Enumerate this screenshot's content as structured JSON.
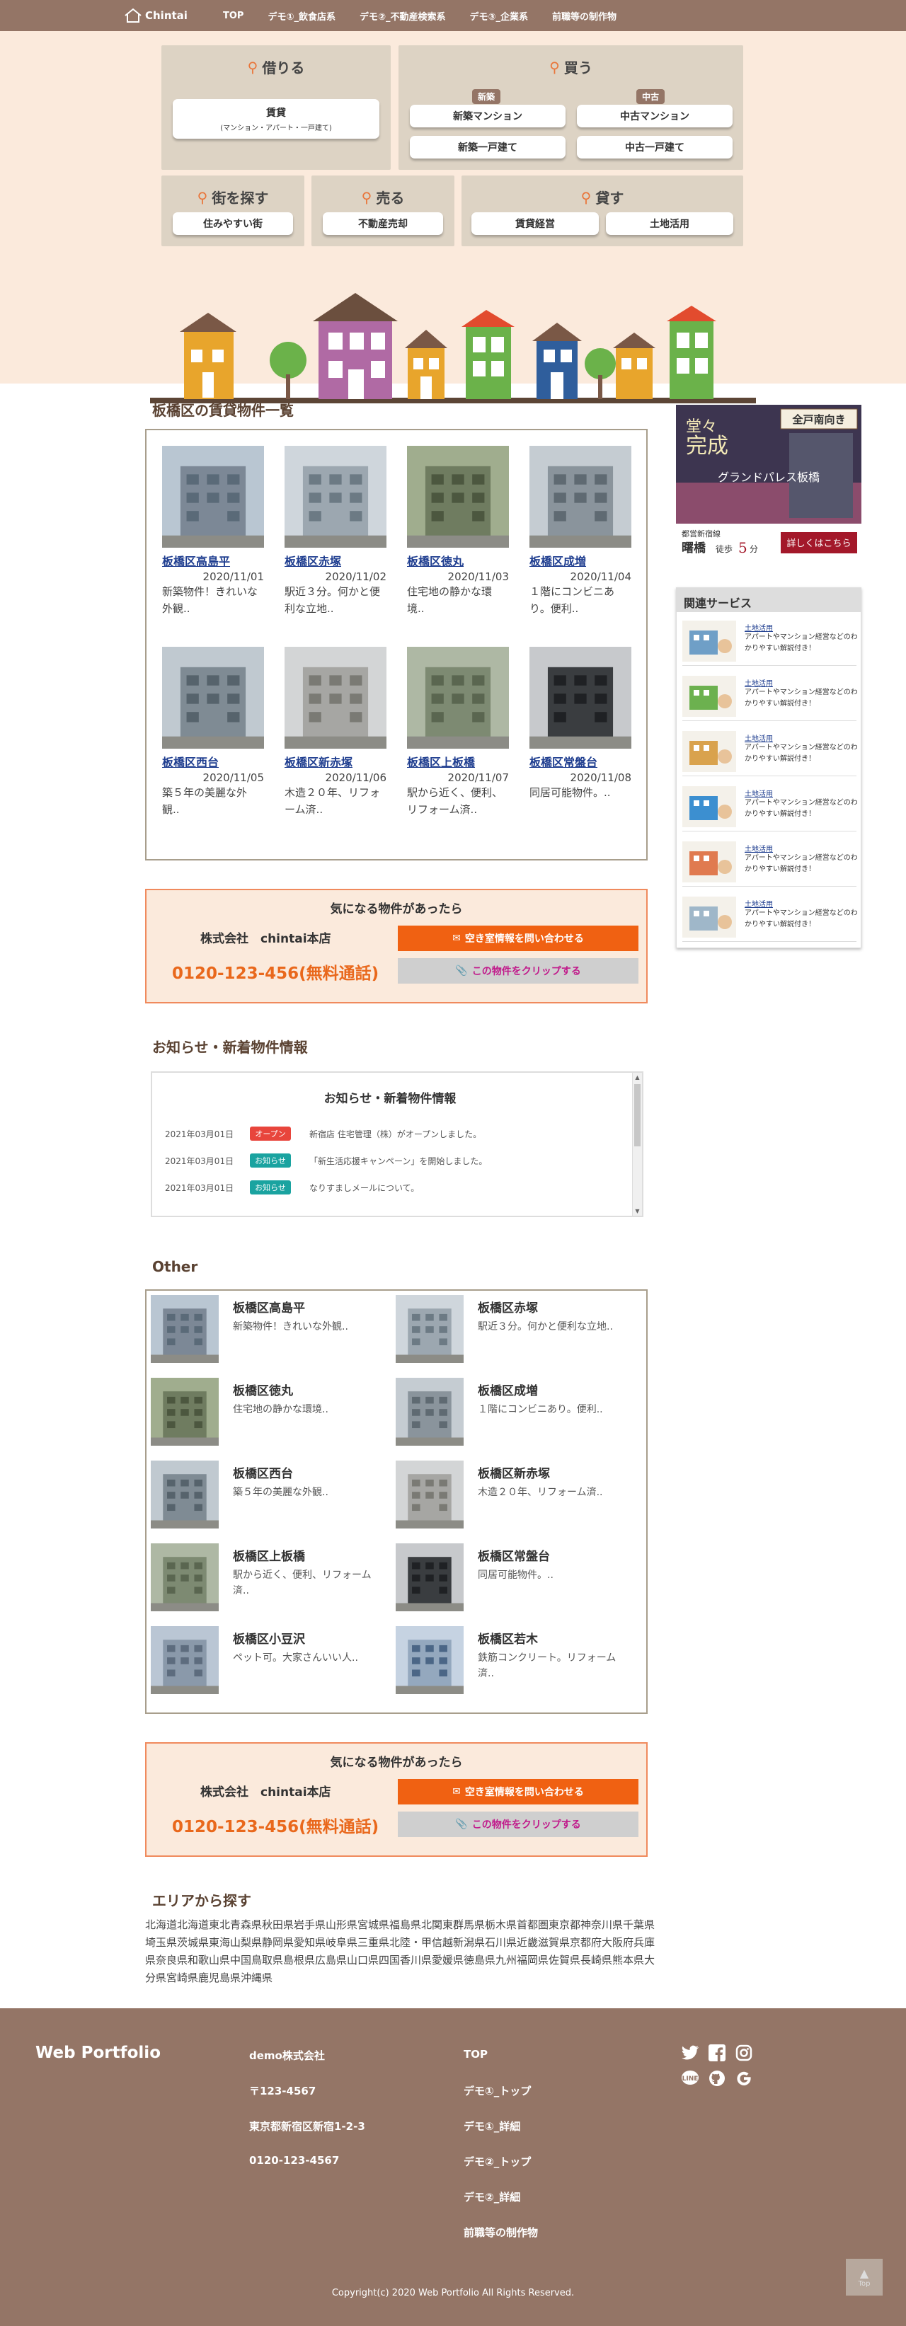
{
  "nav": {
    "logo": "Chintai",
    "links": [
      "TOP",
      "デモ①_飲食店系",
      "デモ②_不動産検索系",
      "デモ③_企業系",
      "前職等の制作物"
    ]
  },
  "hero": {
    "borrow": {
      "title": "借りる",
      "button": "賃貸",
      "button_sub": "(マンション・アパート・一戸建て)"
    },
    "buy": {
      "title": "買う",
      "tag_new": "新築",
      "tag_used": "中古",
      "btn1": "新築マンション",
      "btn2": "中古マンション",
      "btn3": "新築一戸建て",
      "btn4": "中古一戸建て"
    },
    "town": {
      "title": "街を探す",
      "button": "住みやすい街"
    },
    "sell": {
      "title": "売る",
      "button": "不動産売却"
    },
    "lend": {
      "title": "貸す",
      "btn1": "賃貸経営",
      "btn2": "土地活用"
    }
  },
  "listing": {
    "title": "板橋区の賃貸物件一覧",
    "cards": [
      {
        "name": "板橋区高島平",
        "date": "2020/11/01",
        "desc": "新築物件！きれいな外観.."
      },
      {
        "name": "板橋区赤塚",
        "date": "2020/11/02",
        "desc": "駅近３分。何かと便利な立地.."
      },
      {
        "name": "板橋区徳丸",
        "date": "2020/11/03",
        "desc": "住宅地の静かな環境.."
      },
      {
        "name": "板橋区成増",
        "date": "2020/11/04",
        "desc": "１階にコンビニあり。便利.."
      },
      {
        "name": "板橋区西台",
        "date": "2020/11/05",
        "desc": "築５年の美麗な外観.."
      },
      {
        "name": "板橋区新赤塚",
        "date": "2020/11/06",
        "desc": "木造２０年、リフォーム済.."
      },
      {
        "name": "板橋区上板橋",
        "date": "2020/11/07",
        "desc": "駅から近く、便利、リフォーム済.."
      },
      {
        "name": "板橋区常盤台",
        "date": "2020/11/08",
        "desc": "同居可能物件。.."
      }
    ]
  },
  "contact": {
    "title": "気になる物件があったら",
    "company": "株式会社　chintai本店",
    "tel": "0120-123-456(無料通話)",
    "inquiry": "空き室情報を問い合わせる",
    "clip": "この物件をクリップする"
  },
  "news": {
    "section_title": "お知らせ・新着物件情報",
    "box_title": "お知らせ・新着物件情報",
    "items": [
      {
        "date": "2021年03月01日",
        "badge": "オープン",
        "badge_color": "#e8453c",
        "text": "新宿店 住宅管理（株）がオープンしました。"
      },
      {
        "date": "2021年03月01日",
        "badge": "お知らせ",
        "badge_color": "#1aa3a0",
        "text": "「新生活応援キャンペーン」を開始しました。"
      },
      {
        "date": "2021年03月01日",
        "badge": "お知らせ",
        "badge_color": "#1aa3a0",
        "text": "なりすましメールについて。"
      }
    ]
  },
  "other": {
    "title": "Other",
    "items": [
      {
        "name": "板橋区高島平",
        "desc": "新築物件！きれいな外観.."
      },
      {
        "name": "板橋区赤塚",
        "desc": "駅近３分。何かと便利な立地.."
      },
      {
        "name": "板橋区徳丸",
        "desc": "住宅地の静かな環境.."
      },
      {
        "name": "板橋区成増",
        "desc": "１階にコンビニあり。便利.."
      },
      {
        "name": "板橋区西台",
        "desc": "築５年の美麗な外観.."
      },
      {
        "name": "板橋区新赤塚",
        "desc": "木造２０年、リフォーム済.."
      },
      {
        "name": "板橋区上板橋",
        "desc": "駅から近く、便利、リフォーム済.."
      },
      {
        "name": "板橋区常盤台",
        "desc": "同居可能物件。.."
      },
      {
        "name": "板橋区小豆沢",
        "desc": "ペット可。大家さんいい人.."
      },
      {
        "name": "板橋区若木",
        "desc": "鉄筋コンクリート。リフォーム済.."
      }
    ]
  },
  "areas": {
    "title": "エリアから探す",
    "text": "北海道北海道東北青森県秋田県岩手県山形県宮城県福島県北関東群馬県栃木県首都圏東京都神奈川県千葉県埼玉県茨城県東海山梨県静岡県愛知県岐阜県三重県北陸・甲信越新潟県石川県近畿滋賀県京都府大阪府兵庫県奈良県和歌山県中国鳥取県島根県広島県山口県四国香川県愛媛県徳島県九州福岡県佐賀県長崎県熊本県大分県宮崎県鹿児島県沖縄県"
  },
  "sidebar": {
    "ad": {
      "badge": "全戸南向き",
      "line1": "堂々",
      "line2": "完成",
      "name": "グランドパレス板橋",
      "small": "都営新宿線",
      "station": "曙橋",
      "walk": "徒歩",
      "min": "5",
      "unit": "分",
      "cta": "詳しくはこちら"
    },
    "related_title": "関連サービス",
    "related": [
      {
        "link": "土地活用",
        "desc": "アパートやマンション経営などのわかりやすい解説付き！"
      },
      {
        "link": "土地活用",
        "desc": "アパートやマンション経営などのわかりやすい解説付き！"
      },
      {
        "link": "土地活用",
        "desc": "アパートやマンション経営などのわかりやすい解説付き！"
      },
      {
        "link": "土地活用",
        "desc": "アパートやマンション経営などのわかりやすい解説付き！"
      },
      {
        "link": "土地活用",
        "desc": "アパートやマンション経営などのわかりやすい解説付き！"
      },
      {
        "link": "土地活用",
        "desc": "アパートやマンション経営などのわかりやすい解説付き！"
      }
    ]
  },
  "footer": {
    "brand": "Web Portfolio",
    "company": [
      "demo株式会社",
      "〒123-4567",
      "東京都新宿区新宿1-2-3",
      "0120-123-4567"
    ],
    "links": [
      "TOP",
      "デモ①_トップ",
      "デモ①_詳細",
      "デモ②_トップ",
      "デモ②_詳細",
      "前職等の制作物"
    ],
    "copyright": "Copyright(c) 2020 Web Portfolio All Rights Reserved.",
    "totop": "Top"
  }
}
